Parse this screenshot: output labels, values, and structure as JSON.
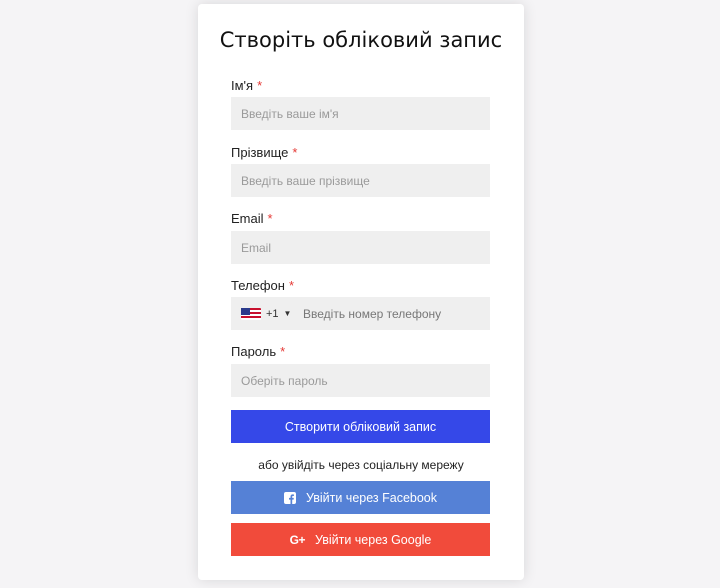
{
  "form": {
    "title": "Створіть обліковий запис",
    "fields": [
      {
        "label": "Ім'я",
        "required_mark": "*",
        "placeholder": "Введіть ваше ім'я",
        "value": ""
      },
      {
        "label": "Прізвище",
        "required_mark": "*",
        "placeholder": "Введіть ваше прізвище",
        "value": ""
      },
      {
        "label": "Email",
        "required_mark": "*",
        "placeholder": "Email",
        "value": ""
      },
      {
        "label": "Телефон",
        "required_mark": "*",
        "placeholder": "Введіть номер телефону",
        "value": "",
        "country_code": "+1",
        "country_flag_icon": "us-flag-icon"
      },
      {
        "label": "Пароль",
        "required_mark": "*",
        "placeholder": "Оберіть пароль",
        "value": ""
      }
    ],
    "submit_label": "Створити обліковий запис",
    "social_divider_text": "або увійдіть через соціальну мережу",
    "facebook_label": "Увійти через Facebook",
    "google_label": "Увійти через Google",
    "google_icon_text": "G+"
  },
  "colors": {
    "primary": "#3548e8",
    "facebook": "#5581d6",
    "google": "#f14b3b",
    "required": "#e53935",
    "input_bg": "#efefef",
    "page_bg": "#f5f4f6"
  }
}
